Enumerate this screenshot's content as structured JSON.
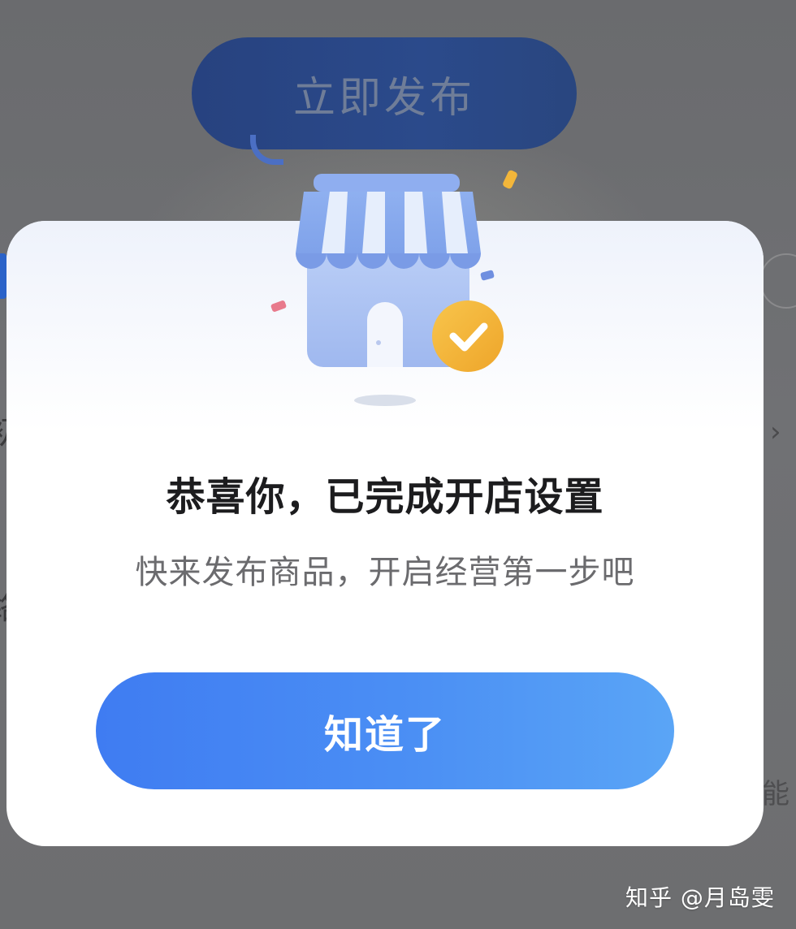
{
  "background": {
    "publish_button_label": "立即发布",
    "chevron": "›",
    "right_edge_fragment": "能",
    "left_edge_fragment_1": "初",
    "left_edge_fragment_2": "络"
  },
  "modal": {
    "illustration_icon": "store-with-checkmark-icon",
    "title": "恭喜你，已完成开店设置",
    "subtitle": "快来发布商品，开启经营第一步吧",
    "confirm_button_label": "知道了"
  },
  "watermark": {
    "text": "知乎 @月岛雯"
  },
  "colors": {
    "accent_blue": "#4b8ff4",
    "check_badge": "#f3b63a",
    "overlay": "#6f6f70"
  }
}
